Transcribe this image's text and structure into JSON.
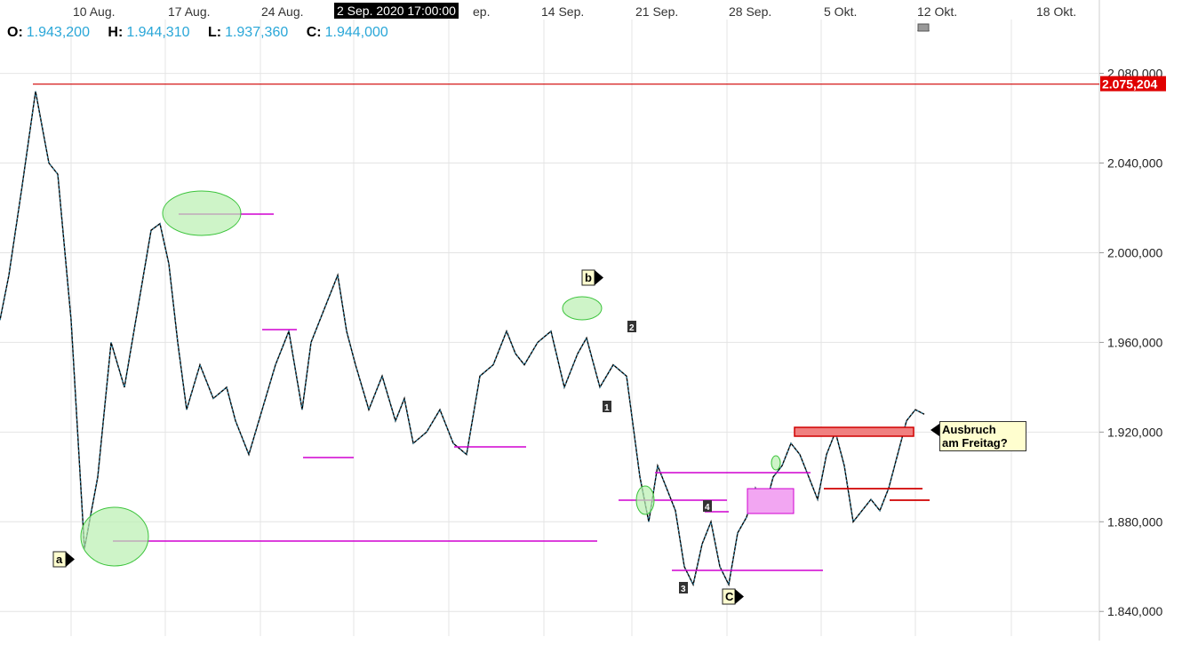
{
  "chart_data": {
    "type": "candlestick-line",
    "x_tick_labels": [
      "10 Aug.",
      "17 Aug.",
      "24 Aug.",
      "2 Sep. 2020 17:00:00",
      "14 Sep.",
      "21 Sep.",
      "28 Sep.",
      "5 Okt.",
      "12 Okt.",
      "18 Okt."
    ],
    "y_tick_labels": [
      "2.080,000",
      "2.040,000",
      "2.000,000",
      "1.960,000",
      "1.920,000",
      "1.880,000",
      "1.840,000"
    ],
    "y_ticks": [
      2080,
      2040,
      2000,
      1960,
      1920,
      1880,
      1840
    ],
    "ylim": [
      1829,
      2104
    ],
    "ohlc": {
      "open_label": "O:",
      "open": "1.943,200",
      "high_label": "H:",
      "high": "1.944,310",
      "low_label": "L:",
      "low": "1.937,360",
      "close_label": "C:",
      "close": "1.944,000"
    },
    "cursor_time": "2 Sep. 2020 17:00:00",
    "resistance_line": {
      "value": 2075.204,
      "label": "2.075,204"
    },
    "price_path": [
      [
        0.0,
        1970
      ],
      [
        0.02,
        1990
      ],
      [
        0.05,
        2030
      ],
      [
        0.08,
        2072
      ],
      [
        0.11,
        2040
      ],
      [
        0.13,
        2035
      ],
      [
        0.16,
        1970
      ],
      [
        0.19,
        1868
      ],
      [
        0.22,
        1900
      ],
      [
        0.25,
        1960
      ],
      [
        0.28,
        1940
      ],
      [
        0.31,
        1975
      ],
      [
        0.34,
        2010
      ],
      [
        0.36,
        2013
      ],
      [
        0.38,
        1995
      ],
      [
        0.4,
        1960
      ],
      [
        0.42,
        1930
      ],
      [
        0.45,
        1950
      ],
      [
        0.48,
        1935
      ],
      [
        0.51,
        1940
      ],
      [
        0.53,
        1925
      ],
      [
        0.56,
        1910
      ],
      [
        0.59,
        1930
      ],
      [
        0.62,
        1950
      ],
      [
        0.65,
        1965
      ],
      [
        0.68,
        1930
      ],
      [
        0.7,
        1960
      ],
      [
        0.73,
        1975
      ],
      [
        0.76,
        1990
      ],
      [
        0.78,
        1965
      ],
      [
        0.8,
        1950
      ],
      [
        0.83,
        1930
      ],
      [
        0.86,
        1945
      ],
      [
        0.89,
        1925
      ],
      [
        0.91,
        1935
      ],
      [
        0.93,
        1915
      ],
      [
        0.96,
        1920
      ],
      [
        0.99,
        1930
      ],
      [
        1.02,
        1915
      ],
      [
        1.05,
        1910
      ],
      [
        1.08,
        1945
      ],
      [
        1.11,
        1950
      ],
      [
        1.14,
        1965
      ],
      [
        1.16,
        1955
      ],
      [
        1.18,
        1950
      ],
      [
        1.21,
        1960
      ],
      [
        1.24,
        1965
      ],
      [
        1.27,
        1940
      ],
      [
        1.3,
        1955
      ],
      [
        1.32,
        1962
      ],
      [
        1.35,
        1940
      ],
      [
        1.38,
        1950
      ],
      [
        1.41,
        1945
      ],
      [
        1.44,
        1900
      ],
      [
        1.46,
        1880
      ],
      [
        1.48,
        1905
      ],
      [
        1.5,
        1895
      ],
      [
        1.52,
        1885
      ],
      [
        1.54,
        1860
      ],
      [
        1.56,
        1852
      ],
      [
        1.58,
        1870
      ],
      [
        1.6,
        1880
      ],
      [
        1.62,
        1860
      ],
      [
        1.64,
        1852
      ],
      [
        1.66,
        1875
      ],
      [
        1.68,
        1882
      ],
      [
        1.7,
        1895
      ],
      [
        1.72,
        1885
      ],
      [
        1.74,
        1900
      ],
      [
        1.76,
        1905
      ],
      [
        1.78,
        1915
      ],
      [
        1.8,
        1910
      ],
      [
        1.82,
        1900
      ],
      [
        1.84,
        1890
      ],
      [
        1.86,
        1910
      ],
      [
        1.88,
        1920
      ],
      [
        1.9,
        1905
      ],
      [
        1.92,
        1880
      ],
      [
        1.94,
        1885
      ],
      [
        1.96,
        1890
      ],
      [
        1.98,
        1885
      ],
      [
        2.0,
        1895
      ],
      [
        2.02,
        1910
      ],
      [
        2.04,
        1925
      ],
      [
        2.06,
        1930
      ],
      [
        2.08,
        1928
      ]
    ],
    "wave_labels": [
      "a",
      "b",
      "C",
      "1",
      "2",
      "3",
      "4"
    ],
    "annotation": [
      "Ausbruch",
      "am Freitag?"
    ]
  },
  "colors": {
    "price_up": "#2aa7d8",
    "price_down": "#000000",
    "resistance": "#d00000",
    "magenta": "#d000d0",
    "green_fill": "#b9f0b0",
    "green_stroke": "#3cc43c",
    "grid": "#e4e4e4"
  }
}
